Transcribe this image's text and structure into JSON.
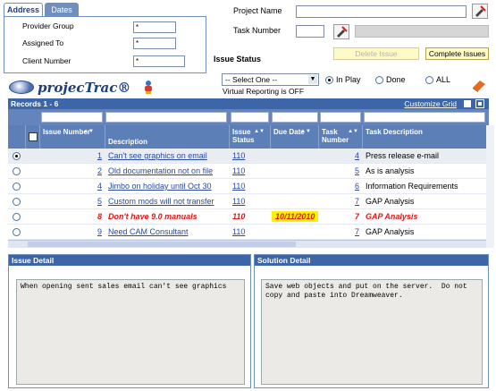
{
  "tabs": [
    {
      "label": "Address"
    },
    {
      "label": "Dates"
    }
  ],
  "address": {
    "provider_group_label": "Provider Group",
    "provider_group_value": "*",
    "assigned_to_label": "Assigned To",
    "assigned_to_value": "*",
    "client_number_label": "Client Number",
    "client_number_value": "*"
  },
  "logo": {
    "text": "projecTrac®"
  },
  "top": {
    "project_name_label": "Project Name",
    "project_name_value": "",
    "task_number_label": "Task Number",
    "task_number_value": ""
  },
  "buttons": {
    "delete_issue": "Delete Issue",
    "complete_issues": "Complete Issues"
  },
  "issue_status": {
    "label": "Issue Status",
    "select_value": "-- Select One --",
    "radios": [
      {
        "label": "In Play",
        "checked": true
      },
      {
        "label": "Done",
        "checked": false
      },
      {
        "label": "ALL",
        "checked": false
      }
    ],
    "virtual_reporting": "Virtual Reporting is OFF"
  },
  "grid": {
    "records_label": "Records 1 - 6",
    "customize_label": "Customize Grid",
    "columns": [
      "Issue Number",
      "Description",
      "Issue Status",
      "Due Date",
      "Task Number",
      "Task Description"
    ],
    "rows": [
      {
        "issue": "1",
        "desc": "Can't see graphics on email",
        "status": "110",
        "due": "",
        "task": "4",
        "task_desc": "Press release e-mail",
        "selected": true,
        "red": false
      },
      {
        "issue": "2",
        "desc": "Old documentation not on file",
        "status": "110",
        "due": "",
        "task": "5",
        "task_desc": "As is analysis",
        "selected": false,
        "red": false
      },
      {
        "issue": "4",
        "desc": "Jimbo on holiday until Oct 30",
        "status": "110",
        "due": "",
        "task": "6",
        "task_desc": "Information Requirements",
        "selected": false,
        "red": false
      },
      {
        "issue": "5",
        "desc": "Custom mods will not transfer",
        "status": "110",
        "due": "",
        "task": "7",
        "task_desc": "GAP Analysis",
        "selected": false,
        "red": false
      },
      {
        "issue": "8",
        "desc": "Don't have 9.0 manuals",
        "status": "110",
        "due": "10/11/2010",
        "task": "7",
        "task_desc": "GAP Analysis",
        "selected": false,
        "red": true
      },
      {
        "issue": "9",
        "desc": "Need CAM Consultant",
        "status": "110",
        "due": "",
        "task": "7",
        "task_desc": "GAP Analysis",
        "selected": false,
        "red": false
      }
    ]
  },
  "issue_detail": {
    "title": "Issue Detail",
    "text": "When opening sent sales email can't see graphics"
  },
  "solution_detail": {
    "title": "Solution Detail",
    "text": "Save web objects and put on the server.  Do not copy and paste into Dreamweaver."
  },
  "colors": {
    "header_blue": "#3d66a8",
    "accent_yellow": "#ffef00",
    "alert_red": "#e31414"
  }
}
